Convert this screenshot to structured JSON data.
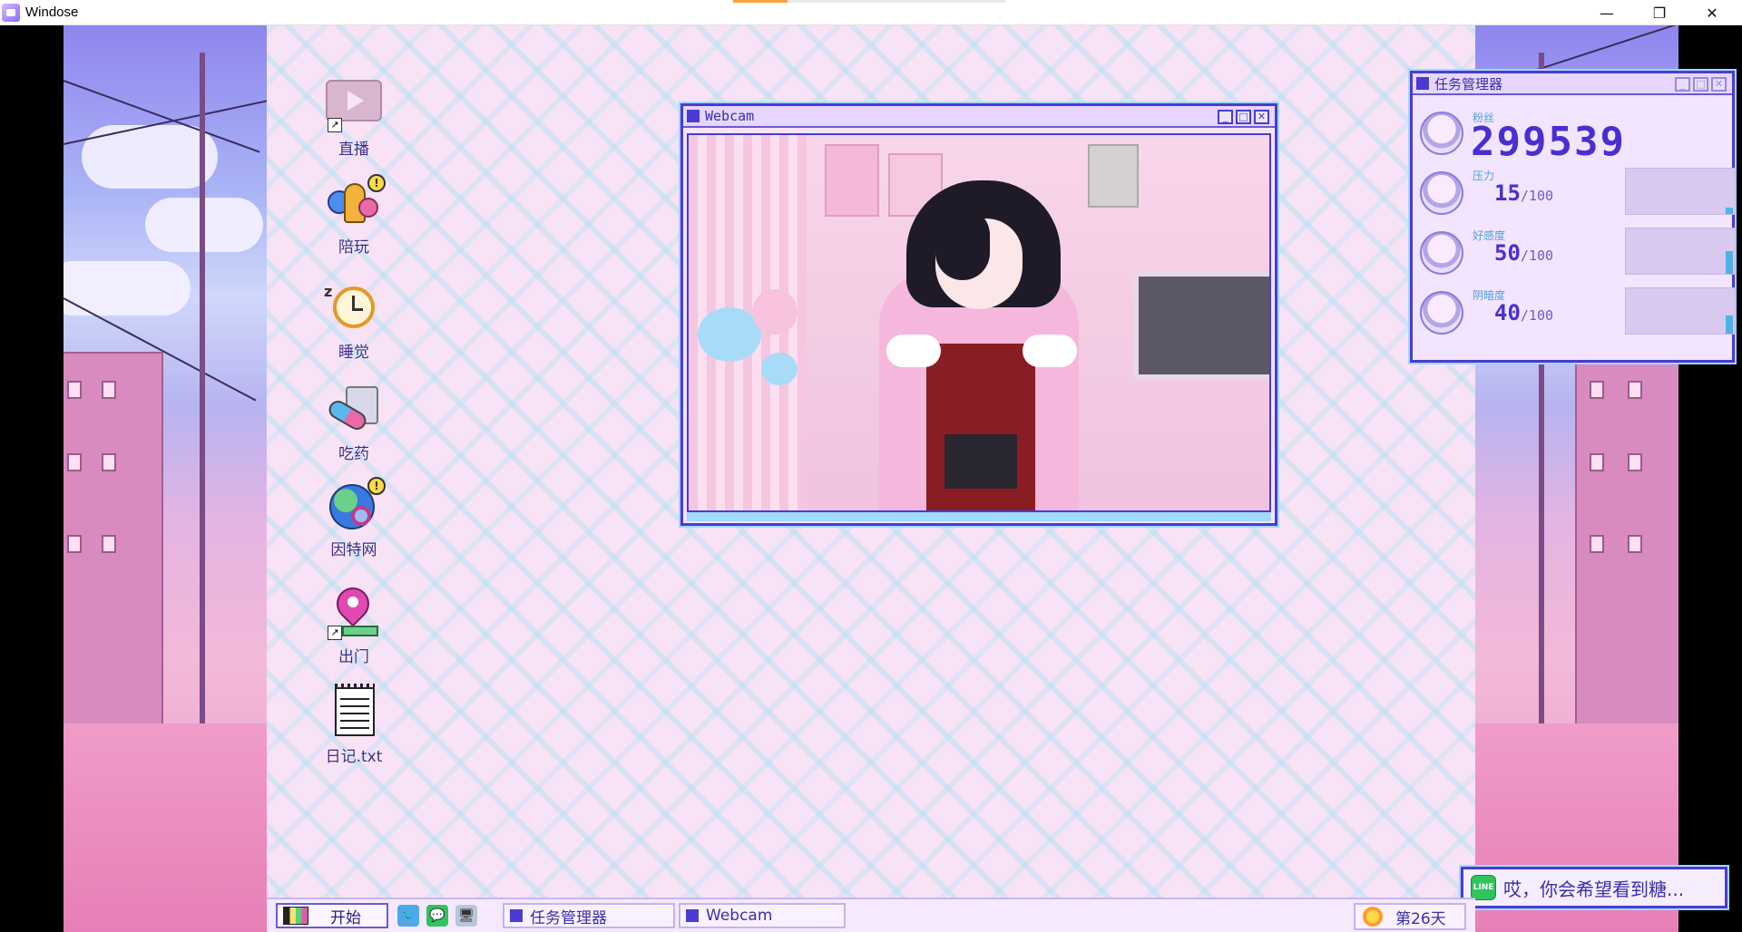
{
  "host_window": {
    "title": "Windose"
  },
  "desktop_icons": [
    {
      "label": "直播"
    },
    {
      "label": "陪玩"
    },
    {
      "label": "睡觉"
    },
    {
      "label": "吃药"
    },
    {
      "label": "因特网"
    },
    {
      "label": "出门"
    },
    {
      "label": "日记.txt"
    }
  ],
  "webcam": {
    "title": "Webcam"
  },
  "task_manager": {
    "title": "任务管理器",
    "followers": {
      "label": "粉丝",
      "value": "299539"
    },
    "stats": [
      {
        "label": "压力",
        "value": "15",
        "max": "/100",
        "level": 0.15
      },
      {
        "label": "好感度",
        "value": "50",
        "max": "/100",
        "level": 0.5
      },
      {
        "label": "阴暗度",
        "value": "40",
        "max": "/100",
        "level": 0.4
      }
    ]
  },
  "notification": {
    "text": "哎，你会希望看到糖..."
  },
  "taskbar": {
    "start_label": "开始",
    "tasks": [
      {
        "label": "任务管理器"
      },
      {
        "label": "Webcam"
      }
    ],
    "day_label": "第26天"
  },
  "colors": {
    "accent": "#4b3bd0",
    "highlight": "#9fd9ff",
    "desktop_bg": "#f8e2f6"
  }
}
